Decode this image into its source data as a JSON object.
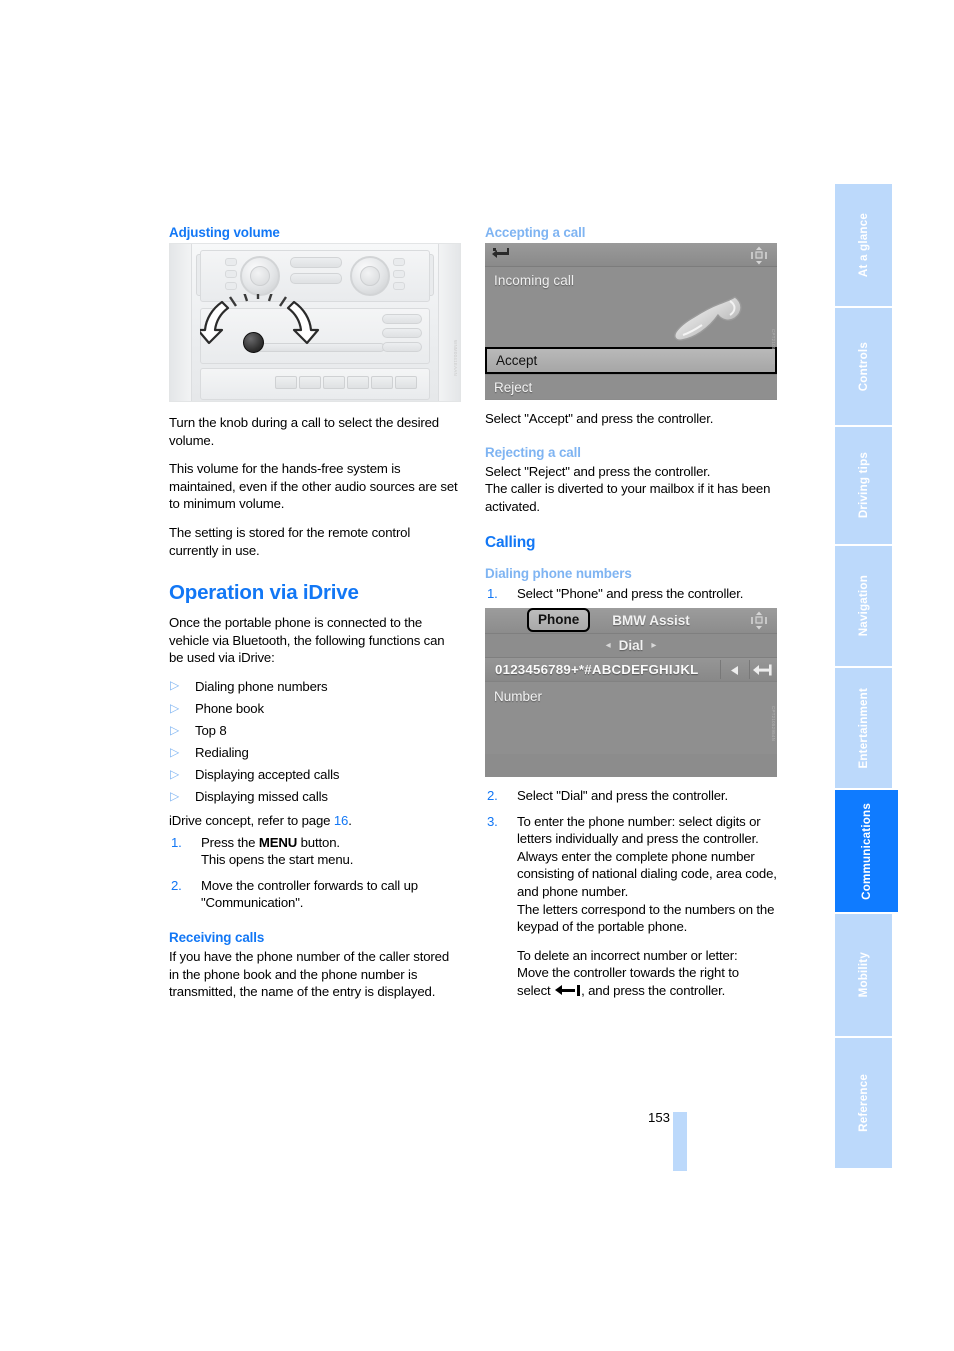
{
  "page": {
    "number": "153"
  },
  "sidebar": {
    "tabs": [
      {
        "label": "At a glance",
        "active": false
      },
      {
        "label": "Controls",
        "active": false
      },
      {
        "label": "Driving tips",
        "active": false
      },
      {
        "label": "Navigation",
        "active": false
      },
      {
        "label": "Entertainment",
        "active": false
      },
      {
        "label": "Communications",
        "active": true
      },
      {
        "label": "Mobility",
        "active": false
      },
      {
        "label": "Reference",
        "active": false
      }
    ],
    "active_color": "#0f7bff",
    "inactive_color": "#bcd9fb"
  },
  "left_column": {
    "heading_adjusting_volume": "Adjusting volume",
    "figure_dashboard": {
      "name": "center-console-volume-knob-illustration",
      "caption_code": "WNM0041EAAN"
    },
    "para_turn_knob": "Turn the knob during a call to select the desired volume.",
    "para_volume_maintained": "This volume for the hands-free system is maintained, even if the other audio sources are set to minimum volume.",
    "para_setting_stored": "The setting is stored for the remote control currently in use.",
    "heading_operation_idrive": "Operation via iDrive",
    "para_intro_idrive": "Once the portable phone is connected to the vehicle via Bluetooth, the following functions can be used via iDrive:",
    "function_list": [
      "Dialing phone numbers",
      "Phone book",
      "Top 8",
      "Redialing",
      "Displaying accepted calls",
      "Displaying missed calls"
    ],
    "para_idrive_concept_pre": "iDrive concept, refer to page ",
    "para_idrive_concept_page": "16",
    "para_idrive_concept_post": ".",
    "steps": [
      {
        "number": "1.",
        "text_pre": "Press the ",
        "text_bold": "MENU",
        "text_post": " button.",
        "text_line2": "This opens the start menu."
      },
      {
        "number": "2.",
        "text_pre": "Move the controller forwards to call up \"Communication\".",
        "text_bold": "",
        "text_post": "",
        "text_line2": ""
      }
    ],
    "heading_receiving_calls": "Receiving calls",
    "para_receiving_calls": "If you have the phone number of the caller stored in the phone book and the phone number is transmitted, the name of the entry is displayed."
  },
  "right_column": {
    "heading_accepting_call": "Accepting a call",
    "figure_incoming_call": {
      "name": "idrive-incoming-call-screen",
      "back_icon": "back-arrow-icon",
      "controller_icon": "four-way-controller-icon",
      "handset_icon": "phone-handset-icon",
      "title": "Incoming call",
      "menu_items": [
        {
          "label": "Accept",
          "selected": true
        },
        {
          "label": "Reject",
          "selected": false
        }
      ],
      "caption_code": "CPT21051954N"
    },
    "para_select_accept": "Select \"Accept\" and press the controller.",
    "heading_rejecting_call": "Rejecting a call",
    "para_select_reject_line1": "Select \"Reject\" and press the controller.",
    "para_select_reject_line2": "The caller is diverted to your mailbox if it has been activated.",
    "heading_calling": "Calling",
    "heading_dialing_phone_numbers": "Dialing phone numbers",
    "step_1": {
      "number": "1.",
      "text": "Select \"Phone\" and press the controller."
    },
    "figure_dial_screen": {
      "name": "idrive-phone-dial-screen",
      "tabs": [
        {
          "label": "Phone",
          "selected": true
        },
        {
          "label": "BMW Assist",
          "selected": false
        }
      ],
      "controller_icon": "four-way-controller-icon",
      "dial_label": "Dial",
      "dial_left_chevron": "◂",
      "dial_right_chevron": "▸",
      "character_strip": "0123456789+*#ABCDEFGHIJKL",
      "strip_left_arrow_icon": "left-triangle-icon",
      "strip_backspace_icon": "backspace-arrow-icon",
      "number_label": "Number",
      "caption_code": "CPT21052954N"
    },
    "step_2": {
      "number": "2.",
      "text": "Select \"Dial\" and press the controller."
    },
    "step_3": {
      "number": "3.",
      "text_block_1": "To enter the phone number: select digits or letters individually and press the controller. Always enter the complete phone number consisting of national dialing code, area code, and phone number.",
      "text_block_2": "The letters correspond to the numbers on the keypad of the portable phone.",
      "text_block_3_line1": "To delete an incorrect number or letter:",
      "text_block_3_line2": "Move the controller towards the right to",
      "text_block_3_line3_pre": "select ",
      "text_block_3_line3_post": ", and press the controller."
    }
  }
}
